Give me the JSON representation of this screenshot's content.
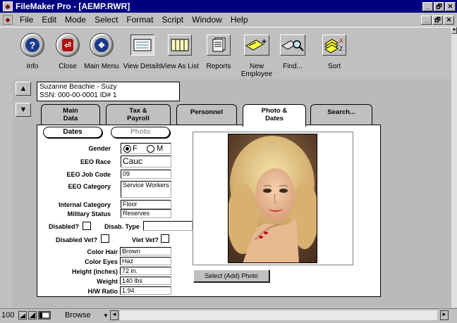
{
  "window": {
    "title": "FileMaker Pro - [AEMP.RWR]",
    "controls": [
      "_",
      "🗗",
      "✕"
    ]
  },
  "menu": [
    "File",
    "Edit",
    "Mode",
    "Select",
    "Format",
    "Script",
    "Window",
    "Help"
  ],
  "toolbar": [
    {
      "label": "Info",
      "icon": "help-icon"
    },
    {
      "label": "Close",
      "icon": "close-icon"
    },
    {
      "label": "Main Menu",
      "icon": "main-menu-icon"
    },
    {
      "label": "View Details",
      "icon": "view-details-icon",
      "pressed": true
    },
    {
      "label": "View As List",
      "icon": "view-list-icon"
    },
    {
      "label": "Reports",
      "icon": "reports-icon"
    },
    {
      "label": "New Employee",
      "icon": "new-employee-icon"
    },
    {
      "label": "Find...",
      "icon": "find-icon"
    },
    {
      "label": "Sort",
      "icon": "sort-icon"
    }
  ],
  "record": {
    "name_line": "Suzanne Beachie  -  Suzy",
    "ssn_line": "SSN: 000-00-0001   ID# 1"
  },
  "tabs": [
    {
      "label": "Main Data"
    },
    {
      "label": "Tax & Payroll"
    },
    {
      "label": "Personnel"
    },
    {
      "label": "Photo & Dates",
      "active": true
    },
    {
      "label": "Search..."
    }
  ],
  "subtabs": {
    "dates": "Dates",
    "photo": "Photo"
  },
  "fields": {
    "gender_label": "Gender",
    "gender_f": "F",
    "gender_m": "M",
    "eeo_race_label": "EEO Race",
    "eeo_race": "Cauc",
    "eeo_job_code_label": "EEO Job Code",
    "eeo_job_code": "09",
    "eeo_category_label": "EEO Category",
    "eeo_category": "Service Workers",
    "internal_category_label": "Internal Category",
    "internal_category": "Floor",
    "military_status_label": "Military Status",
    "military_status": "Reserves",
    "disabled_label": "Disabled?",
    "disab_type_label": "Disab. Type",
    "disab_type": "",
    "disabled_vet_label": "Disabled Vet?",
    "viet_vet_label": "Viet Vet?",
    "color_hair_label": "Color Hair",
    "color_hair": "Brown",
    "color_eyes_label": "Color Eyes",
    "color_eyes": "Haz",
    "height_label": "Height (inches)",
    "height": "72 in.",
    "weight_label": "Weight",
    "weight": "140 lbs",
    "hw_ratio_label": "H/W Ratio",
    "hw_ratio": "1.94"
  },
  "select_photo_button": "Select (Add) Photo",
  "status": {
    "zoom": "100",
    "mode": "Browse"
  }
}
